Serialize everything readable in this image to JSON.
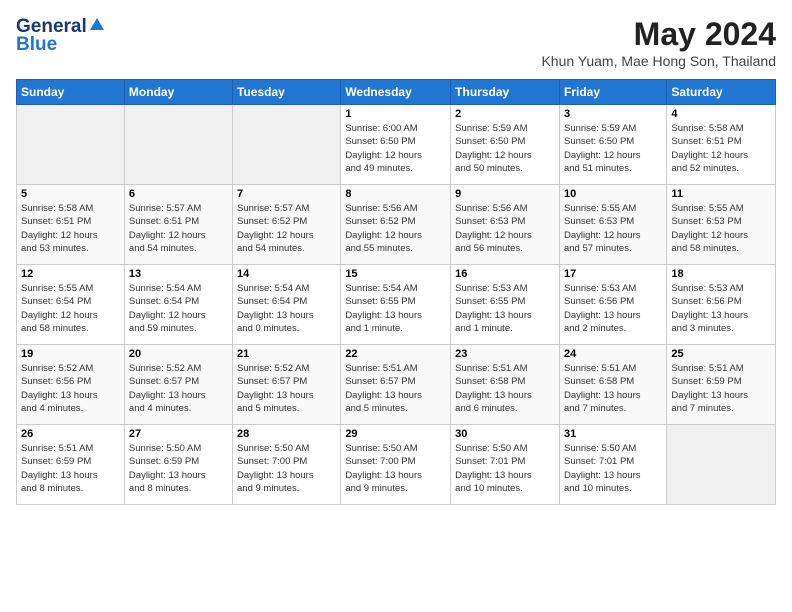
{
  "header": {
    "logo_general": "General",
    "logo_blue": "Blue",
    "title": "May 2024",
    "subtitle": "Khun Yuam, Mae Hong Son, Thailand"
  },
  "days_of_week": [
    "Sunday",
    "Monday",
    "Tuesday",
    "Wednesday",
    "Thursday",
    "Friday",
    "Saturday"
  ],
  "weeks": [
    [
      {
        "day": "",
        "info": ""
      },
      {
        "day": "",
        "info": ""
      },
      {
        "day": "",
        "info": ""
      },
      {
        "day": "1",
        "info": "Sunrise: 6:00 AM\nSunset: 6:50 PM\nDaylight: 12 hours\nand 49 minutes."
      },
      {
        "day": "2",
        "info": "Sunrise: 5:59 AM\nSunset: 6:50 PM\nDaylight: 12 hours\nand 50 minutes."
      },
      {
        "day": "3",
        "info": "Sunrise: 5:59 AM\nSunset: 6:50 PM\nDaylight: 12 hours\nand 51 minutes."
      },
      {
        "day": "4",
        "info": "Sunrise: 5:58 AM\nSunset: 6:51 PM\nDaylight: 12 hours\nand 52 minutes."
      }
    ],
    [
      {
        "day": "5",
        "info": "Sunrise: 5:58 AM\nSunset: 6:51 PM\nDaylight: 12 hours\nand 53 minutes."
      },
      {
        "day": "6",
        "info": "Sunrise: 5:57 AM\nSunset: 6:51 PM\nDaylight: 12 hours\nand 54 minutes."
      },
      {
        "day": "7",
        "info": "Sunrise: 5:57 AM\nSunset: 6:52 PM\nDaylight: 12 hours\nand 54 minutes."
      },
      {
        "day": "8",
        "info": "Sunrise: 5:56 AM\nSunset: 6:52 PM\nDaylight: 12 hours\nand 55 minutes."
      },
      {
        "day": "9",
        "info": "Sunrise: 5:56 AM\nSunset: 6:53 PM\nDaylight: 12 hours\nand 56 minutes."
      },
      {
        "day": "10",
        "info": "Sunrise: 5:55 AM\nSunset: 6:53 PM\nDaylight: 12 hours\nand 57 minutes."
      },
      {
        "day": "11",
        "info": "Sunrise: 5:55 AM\nSunset: 6:53 PM\nDaylight: 12 hours\nand 58 minutes."
      }
    ],
    [
      {
        "day": "12",
        "info": "Sunrise: 5:55 AM\nSunset: 6:54 PM\nDaylight: 12 hours\nand 58 minutes."
      },
      {
        "day": "13",
        "info": "Sunrise: 5:54 AM\nSunset: 6:54 PM\nDaylight: 12 hours\nand 59 minutes."
      },
      {
        "day": "14",
        "info": "Sunrise: 5:54 AM\nSunset: 6:54 PM\nDaylight: 13 hours\nand 0 minutes."
      },
      {
        "day": "15",
        "info": "Sunrise: 5:54 AM\nSunset: 6:55 PM\nDaylight: 13 hours\nand 1 minute."
      },
      {
        "day": "16",
        "info": "Sunrise: 5:53 AM\nSunset: 6:55 PM\nDaylight: 13 hours\nand 1 minute."
      },
      {
        "day": "17",
        "info": "Sunrise: 5:53 AM\nSunset: 6:56 PM\nDaylight: 13 hours\nand 2 minutes."
      },
      {
        "day": "18",
        "info": "Sunrise: 5:53 AM\nSunset: 6:56 PM\nDaylight: 13 hours\nand 3 minutes."
      }
    ],
    [
      {
        "day": "19",
        "info": "Sunrise: 5:52 AM\nSunset: 6:56 PM\nDaylight: 13 hours\nand 4 minutes."
      },
      {
        "day": "20",
        "info": "Sunrise: 5:52 AM\nSunset: 6:57 PM\nDaylight: 13 hours\nand 4 minutes."
      },
      {
        "day": "21",
        "info": "Sunrise: 5:52 AM\nSunset: 6:57 PM\nDaylight: 13 hours\nand 5 minutes."
      },
      {
        "day": "22",
        "info": "Sunrise: 5:51 AM\nSunset: 6:57 PM\nDaylight: 13 hours\nand 5 minutes."
      },
      {
        "day": "23",
        "info": "Sunrise: 5:51 AM\nSunset: 6:58 PM\nDaylight: 13 hours\nand 6 minutes."
      },
      {
        "day": "24",
        "info": "Sunrise: 5:51 AM\nSunset: 6:58 PM\nDaylight: 13 hours\nand 7 minutes."
      },
      {
        "day": "25",
        "info": "Sunrise: 5:51 AM\nSunset: 6:59 PM\nDaylight: 13 hours\nand 7 minutes."
      }
    ],
    [
      {
        "day": "26",
        "info": "Sunrise: 5:51 AM\nSunset: 6:59 PM\nDaylight: 13 hours\nand 8 minutes."
      },
      {
        "day": "27",
        "info": "Sunrise: 5:50 AM\nSunset: 6:59 PM\nDaylight: 13 hours\nand 8 minutes."
      },
      {
        "day": "28",
        "info": "Sunrise: 5:50 AM\nSunset: 7:00 PM\nDaylight: 13 hours\nand 9 minutes."
      },
      {
        "day": "29",
        "info": "Sunrise: 5:50 AM\nSunset: 7:00 PM\nDaylight: 13 hours\nand 9 minutes."
      },
      {
        "day": "30",
        "info": "Sunrise: 5:50 AM\nSunset: 7:01 PM\nDaylight: 13 hours\nand 10 minutes."
      },
      {
        "day": "31",
        "info": "Sunrise: 5:50 AM\nSunset: 7:01 PM\nDaylight: 13 hours\nand 10 minutes."
      },
      {
        "day": "",
        "info": ""
      }
    ]
  ]
}
